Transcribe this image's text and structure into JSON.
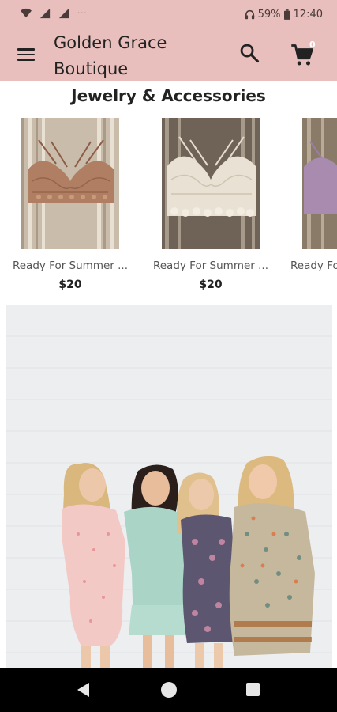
{
  "status_bar": {
    "battery": "59%",
    "time": "12:40",
    "icons": [
      "wifi-icon",
      "signal-icon",
      "signal-icon",
      "more-notifications-icon",
      "headphones-icon",
      "battery-icon"
    ]
  },
  "app_bar": {
    "title": "Golden Grace Boutique",
    "cart_count": "0",
    "icons": [
      "menu-icon",
      "search-icon",
      "cart-icon"
    ]
  },
  "section": {
    "title": "Jewelry & Accessories",
    "products": [
      {
        "name": "Ready For Summer ...",
        "price": "$20",
        "color": "#b08063"
      },
      {
        "name": "Ready For Summer ...",
        "price": "$20",
        "color": "#e8dfd2"
      },
      {
        "name": "Ready Fo",
        "price": "",
        "color": "#a98bb0"
      }
    ]
  },
  "colors": {
    "accent": "#e8bfbc",
    "nav_bar": "#000000"
  },
  "nav_bar": {
    "icons": [
      "back-icon",
      "home-icon",
      "recents-icon"
    ]
  }
}
